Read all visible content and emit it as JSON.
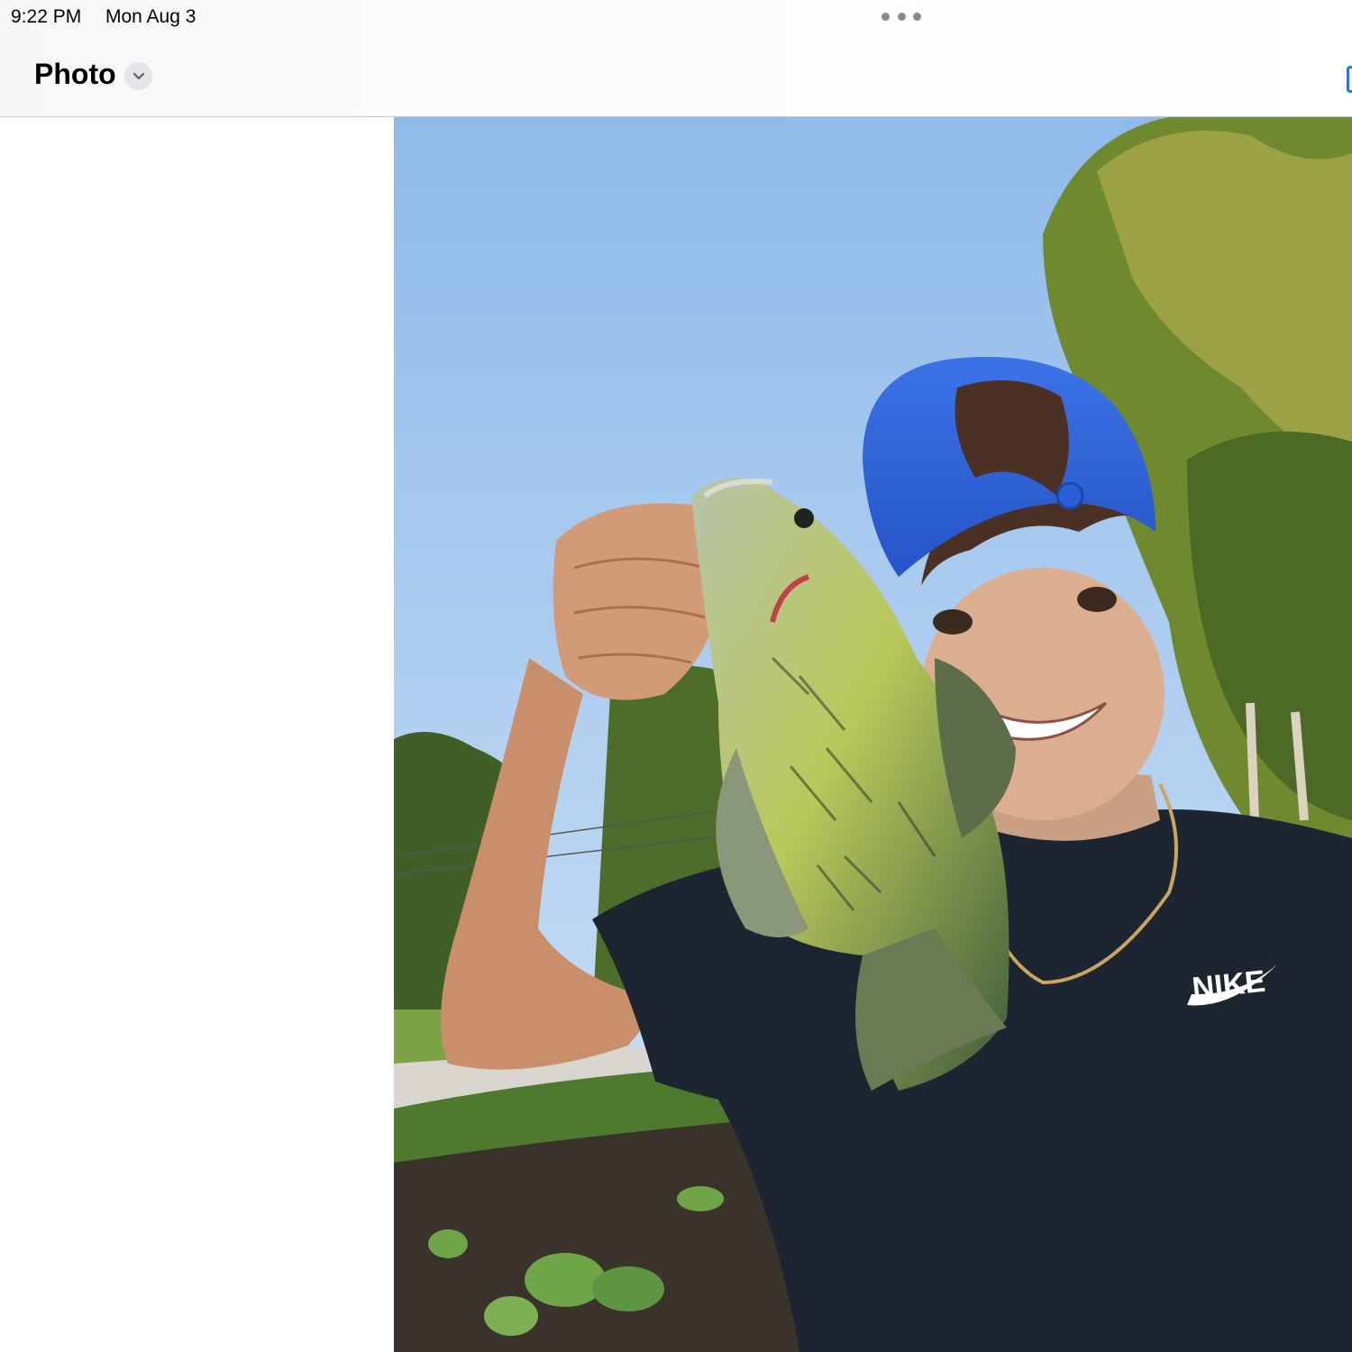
{
  "status_bar": {
    "time": "9:22 PM",
    "date": "Mon Aug 3"
  },
  "nav": {
    "title": "Photo",
    "title_menu_icon": "chevron-down-icon",
    "multitask_icon": "ellipsis-icon"
  },
  "photo": {
    "shirt_logo_text": "NIKE"
  },
  "colors": {
    "accent": "#1a7cf5",
    "sky": "#a9cdf0",
    "cap": "#2f62d8",
    "shirt": "#1c2530"
  }
}
